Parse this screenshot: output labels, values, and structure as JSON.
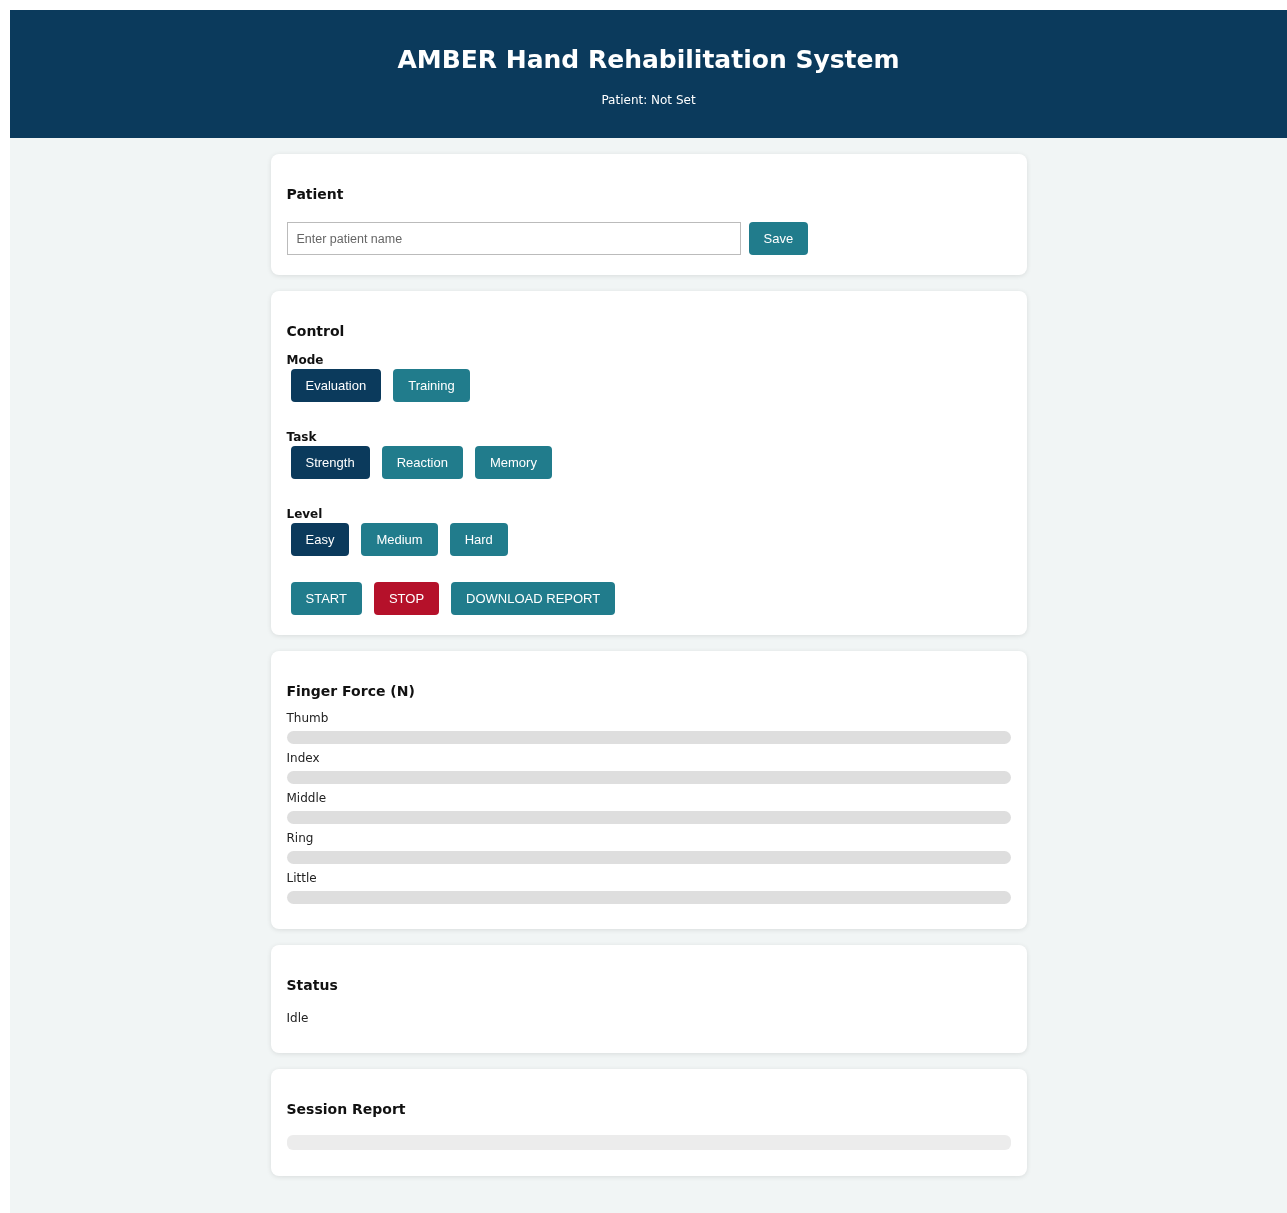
{
  "header": {
    "title": "AMBER Hand Rehabilitation System",
    "subtitle": "Patient: Not Set"
  },
  "patient": {
    "title": "Patient",
    "field": {
      "placeholder": "Enter patient name"
    },
    "button": "Save"
  },
  "control": {
    "title": "Control",
    "groups": [
      {
        "label": "Mode",
        "options": [
          {
            "label": "Evaluation",
            "selected": true
          },
          {
            "label": "Training",
            "selected": false
          }
        ]
      },
      {
        "label": "Task",
        "options": [
          {
            "label": "Strength",
            "selected": true
          },
          {
            "label": "Reaction",
            "selected": false
          },
          {
            "label": "Memory",
            "selected": false
          }
        ]
      },
      {
        "label": "Level",
        "options": [
          {
            "label": "Easy",
            "selected": true
          },
          {
            "label": "Medium",
            "selected": false
          },
          {
            "label": "Hard",
            "selected": false
          }
        ]
      }
    ],
    "actions": [
      {
        "label": "START",
        "kind": "primary"
      },
      {
        "label": "STOP",
        "kind": "danger"
      },
      {
        "label": "DOWNLOAD REPORT",
        "kind": "primary"
      }
    ]
  },
  "finger_force": {
    "title": "Finger Force (N)",
    "fingers": [
      {
        "name": "Thumb"
      },
      {
        "name": "Index"
      },
      {
        "name": "Middle"
      },
      {
        "name": "Ring"
      },
      {
        "name": "Little"
      }
    ]
  },
  "status": {
    "title": "Status",
    "text": "Idle"
  },
  "session_report": {
    "title": "Session Report"
  }
}
